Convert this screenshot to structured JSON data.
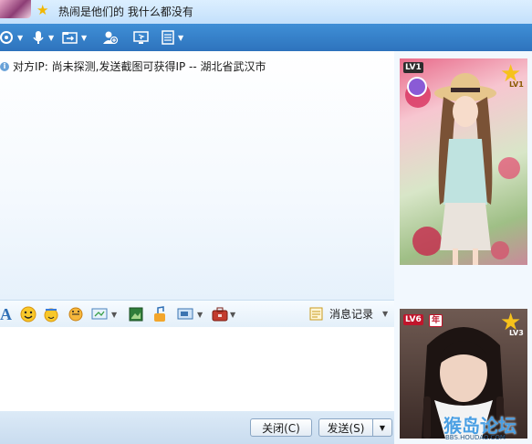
{
  "window": {
    "title": "热闹是他们的 我什么都没有"
  },
  "toolbar": {
    "icons": [
      "video-call-icon",
      "voice-call-icon",
      "file-transfer-icon",
      "add-friend-icon",
      "remote-assist-icon",
      "more-apps-icon"
    ]
  },
  "chat": {
    "ip_notice": "对方IP: 尚未探测,发送截图可获得IP -- 湖北省武汉市"
  },
  "input_toolbar": {
    "font_icon_label": "A",
    "history_label": "消息记录"
  },
  "buttons": {
    "close_label": "关闭(C)",
    "send_label": "发送(S)"
  },
  "profile_show_friend": {
    "badge_text": "LV1",
    "star_level": "LV1"
  },
  "profile_show_self": {
    "badge_text": "LV6",
    "year_badge": "年",
    "star_level": "LV3"
  },
  "watermark": {
    "text": "猴岛论坛",
    "url": "BBS.HOUDAO.COM"
  },
  "colors": {
    "toolbar_bg": "#3a86cf",
    "title_bg": "#cfe7fd",
    "accent": "#4a9fe3"
  }
}
